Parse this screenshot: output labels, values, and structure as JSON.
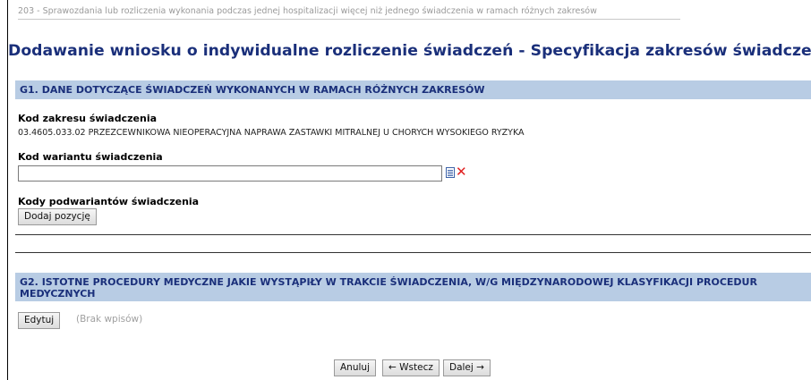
{
  "breadcrumb": "203 - Sprawozdania lub rozliczenia wykonania podczas jednej hospitalizacji więcej niż jednego świadczenia w ramach różnych zakresów",
  "page_title": "Dodawanie wniosku o indywidualne rozliczenie świadczeń - Specyfikacja zakresów świadczeń",
  "section_g1": {
    "title": "G1. DANE DOTYCZĄCE ŚWIADCZEŃ WYKONANYCH W RAMACH RÓŻNYCH ZAKRESÓW",
    "kod_zakresu_label": "Kod zakresu świadczenia",
    "kod_zakresu_value": "03.4605.033.02 PRZEZCEWNIKOWA NIEOPERACYJNA NAPRAWA ZASTAWKI MITRALNEJ U CHORYCH WYSOKIEGO RYZYKA",
    "kod_wariantu_label": "Kod wariantu świadczenia",
    "kod_wariantu_value": "",
    "kody_podwariantow_label": "Kody podwariantów świadczenia",
    "dodaj_button": "Dodaj pozycję"
  },
  "section_g2": {
    "title": "G2. ISTOTNE PROCEDURY MEDYCZNE JAKIE WYSTĄPIŁY W TRAKCIE ŚWIADCZENIA, W/G MIĘDZYNARODOWEJ KLASYFIKACJI PROCEDUR MEDYCZNYCH",
    "edytuj_button": "Edytuj",
    "empty_note": "(Brak wpisów)"
  },
  "footer": {
    "anuluj": "Anuluj",
    "wstecz": "← Wstecz",
    "dalej": "Dalej →"
  },
  "icons": {
    "list_icon": "list-icon",
    "clear_icon": "clear-icon",
    "clear_glyph": "✕"
  },
  "colors": {
    "title": "#1a2f7a",
    "section_bg": "#b8cce4",
    "clear": "#e02020"
  }
}
